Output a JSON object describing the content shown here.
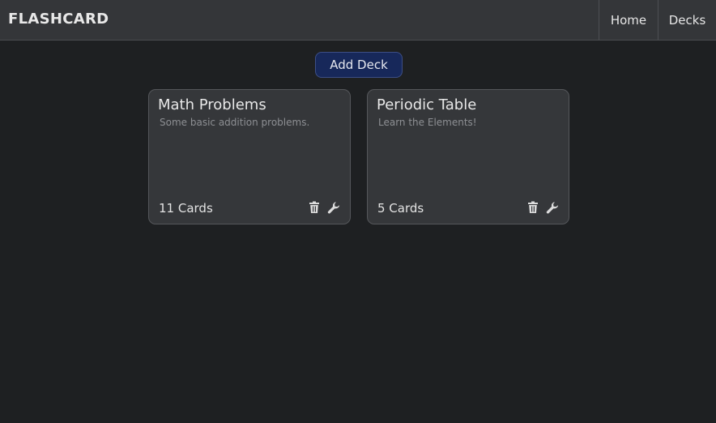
{
  "navbar": {
    "brand": "FLASHCARD",
    "links": [
      {
        "label": "Home"
      },
      {
        "label": "Decks"
      }
    ]
  },
  "actions": {
    "add_deck_label": "Add Deck"
  },
  "decks": [
    {
      "title": "Math Problems",
      "description": "Some basic addition problems.",
      "count_label": "11 Cards",
      "icons": [
        "trash-icon",
        "wrench-icon"
      ]
    },
    {
      "title": "Periodic Table",
      "description": "Learn the Elements!",
      "count_label": "5 Cards",
      "icons": [
        "trash-icon",
        "wrench-icon"
      ]
    }
  ],
  "colors": {
    "background": "#1e2022",
    "navbar": "#343639",
    "card": "#35373a",
    "primary_button": "#17285a"
  }
}
